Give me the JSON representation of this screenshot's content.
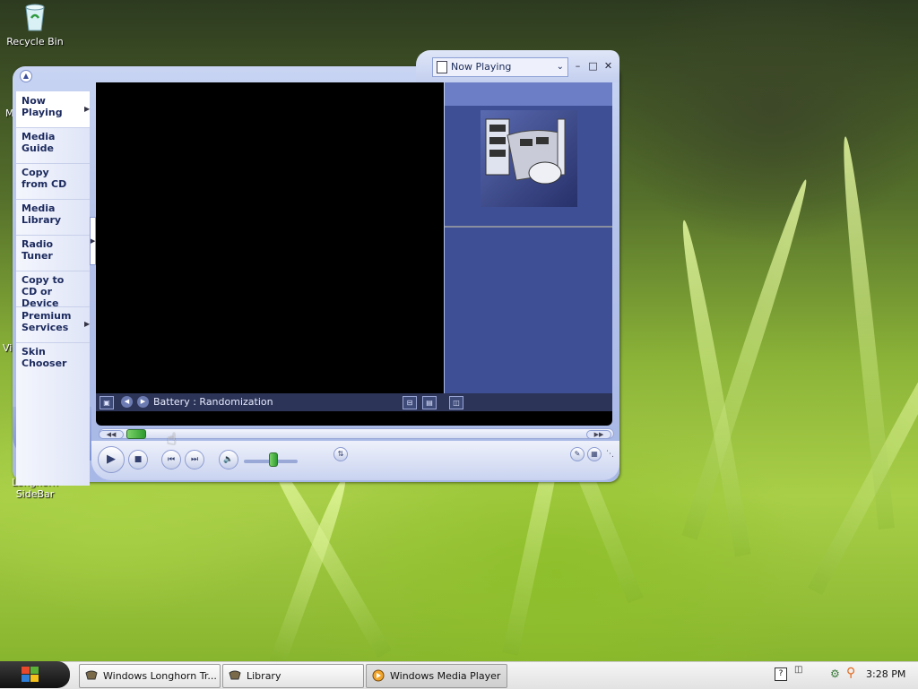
{
  "desktop": {
    "icons": [
      {
        "name": "recycle-bin",
        "label": "Recycle Bin"
      },
      {
        "name": "longhorn-sidebar",
        "label": "Longhorn SideBar"
      }
    ],
    "edge_text": [
      "M",
      "Vi"
    ]
  },
  "wmp": {
    "now_playing_select": "Now Playing",
    "window_controls": {
      "minimize": "–",
      "maximize": "□",
      "close": "✕"
    },
    "taskpane": [
      {
        "label": "Now Playing",
        "has_arrow": true,
        "active": true
      },
      {
        "label": "Media Guide",
        "has_arrow": false
      },
      {
        "label": "Copy from CD",
        "has_arrow": false
      },
      {
        "label": "Media Library",
        "has_arrow": false
      },
      {
        "label": "Radio Tuner",
        "has_arrow": false
      },
      {
        "label": "Copy to CD or Device",
        "has_arrow": false
      },
      {
        "label": "Premium Services",
        "has_arrow": true
      },
      {
        "label": "Skin Chooser",
        "has_arrow": false
      }
    ],
    "info_text": "Battery : Randomization",
    "colors": {
      "video_bg": "#000000",
      "pane_bg": "#3e4f96",
      "accent": "#2e9a2e"
    }
  },
  "taskbar": {
    "buttons": [
      {
        "label": "Windows Longhorn Tr...",
        "icon": "longhorn-window-icon"
      },
      {
        "label": "Library",
        "icon": "library-window-icon"
      },
      {
        "label": "Windows Media Player",
        "icon": "media-player-icon",
        "active": true
      }
    ],
    "clock": "3:28 PM"
  }
}
